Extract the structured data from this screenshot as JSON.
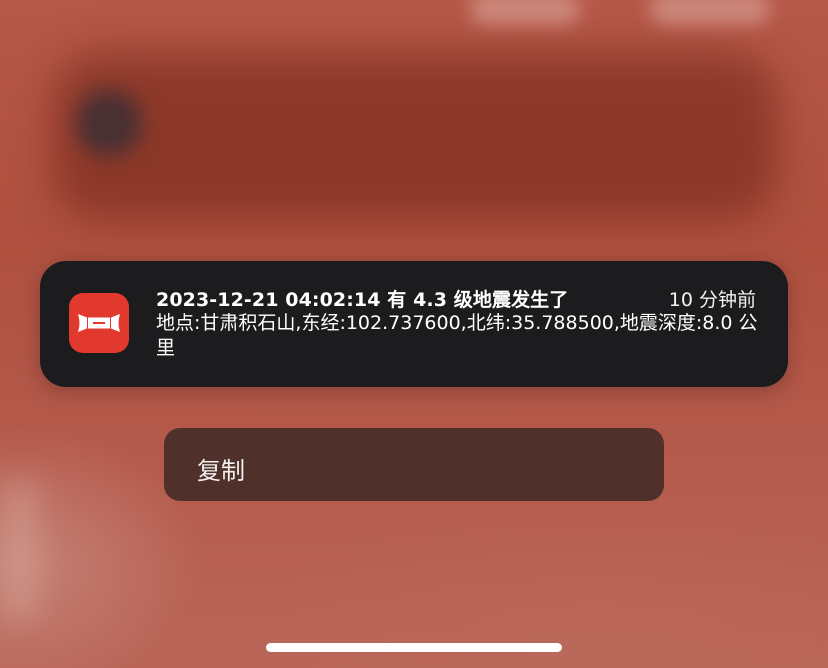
{
  "notification": {
    "title": "2023-12-21 04:02:14 有 4.3 级地震发生了",
    "time": "10 分钟前",
    "body": "地点:甘肃积石山,东经:102.737600,北纬:35.788500,地震深度:8.0 公里",
    "app_icon": "scroll-icon",
    "app_icon_color": "#e2392f"
  },
  "context_menu": {
    "items": [
      {
        "label": "复制"
      }
    ]
  }
}
